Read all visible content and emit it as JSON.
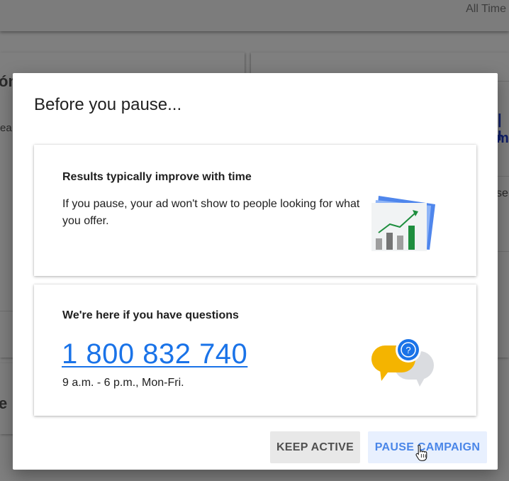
{
  "background": {
    "time_filter": "All Time",
    "fragments": {
      "left_title": "ón",
      "left_sub": "ea",
      "right_link_1": "| I",
      "right_link_2": "m",
      "right_text": "se",
      "left_bottom": "e"
    }
  },
  "dialog": {
    "title": "Before you pause...",
    "results_card": {
      "heading": "Results typically improve with time",
      "body": "If you pause, your ad won't show to people looking for what you offer.",
      "illustration": "chart-growth-icon"
    },
    "support_card": {
      "heading": "We're here if you have questions",
      "phone": "1 800 832 740",
      "hours": "9 a.m. - 6 p.m., Mon-Fri.",
      "illustration": "chat-question-icon"
    },
    "buttons": {
      "keep_active": "KEEP ACTIVE",
      "pause_campaign": "PAUSE CAMPAIGN"
    }
  },
  "colors": {
    "accent_blue": "#1a73e8",
    "pause_button_bg": "#e8f0fe",
    "keep_button_bg": "#e8e8e8",
    "chart_green": "#1e8e3e",
    "chat_yellow": "#f4b400"
  }
}
